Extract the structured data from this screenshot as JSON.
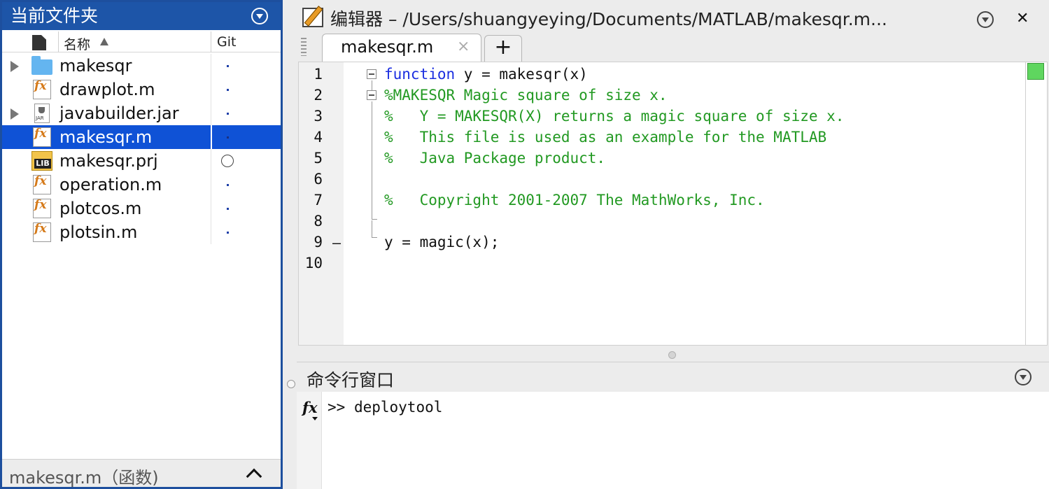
{
  "current_folder": {
    "title": "当前文件夹",
    "column_name": "名称",
    "column_git": "Git",
    "files": [
      {
        "name": "makesqr",
        "icon": "folder-icon",
        "expandable": true,
        "selected": false,
        "git": "dot"
      },
      {
        "name": "drawplot.m",
        "icon": "m-file-icon",
        "expandable": false,
        "selected": false,
        "git": "dot"
      },
      {
        "name": "javabuilder.jar",
        "icon": "jar-file-icon",
        "expandable": true,
        "selected": false,
        "git": "dot"
      },
      {
        "name": "makesqr.m",
        "icon": "m-file-icon",
        "expandable": false,
        "selected": true,
        "git": "dot"
      },
      {
        "name": "makesqr.prj",
        "icon": "project-lib-icon",
        "expandable": false,
        "selected": false,
        "git": "circle"
      },
      {
        "name": "operation.m",
        "icon": "m-file-icon",
        "expandable": false,
        "selected": false,
        "git": "dot"
      },
      {
        "name": "plotcos.m",
        "icon": "m-file-icon",
        "expandable": false,
        "selected": false,
        "git": "dot"
      },
      {
        "name": "plotsin.m",
        "icon": "m-file-icon",
        "expandable": false,
        "selected": false,
        "git": "dot"
      }
    ],
    "footer": "makesqr.m（函数)"
  },
  "editor": {
    "title": "编辑器 – /Users/shuangyeying/Documents/MATLAB/makesqr.m...",
    "tab_label": "makesqr.m",
    "tab_add_label": "+",
    "close_label": "✕",
    "line_numbers": [
      "1",
      "2",
      "3",
      "4",
      "5",
      "6",
      "7",
      "8",
      "9",
      "10"
    ],
    "line9_marker": "–",
    "code": [
      {
        "keyword": "function",
        "text": " y = makesqr(x)",
        "type": "code"
      },
      {
        "keyword": "",
        "text": "%MAKESQR Magic square of size x.",
        "type": "comment"
      },
      {
        "keyword": "",
        "text": "%   Y = MAKESQR(X) returns a magic square of size x.",
        "type": "comment"
      },
      {
        "keyword": "",
        "text": "%   This file is used as an example for the MATLAB",
        "type": "comment"
      },
      {
        "keyword": "",
        "text": "%   Java Package product.",
        "type": "comment"
      },
      {
        "keyword": "",
        "text": "",
        "type": "code"
      },
      {
        "keyword": "",
        "text": "%   Copyright 2001-2007 The MathWorks, Inc.",
        "type": "comment"
      },
      {
        "keyword": "",
        "text": "",
        "type": "code"
      },
      {
        "keyword": "",
        "text": "y = magic(x);",
        "type": "code"
      },
      {
        "keyword": "",
        "text": "",
        "type": "code"
      }
    ],
    "colors": {
      "keyword": "#1b2ee0",
      "comment": "#229922",
      "status_ok": "#5fd65f",
      "selection": "#0f52d6",
      "panel_title": "#1d55a8"
    }
  },
  "command_window": {
    "title": "命令行窗口",
    "prompt": ">> ",
    "command": "deploytool"
  }
}
